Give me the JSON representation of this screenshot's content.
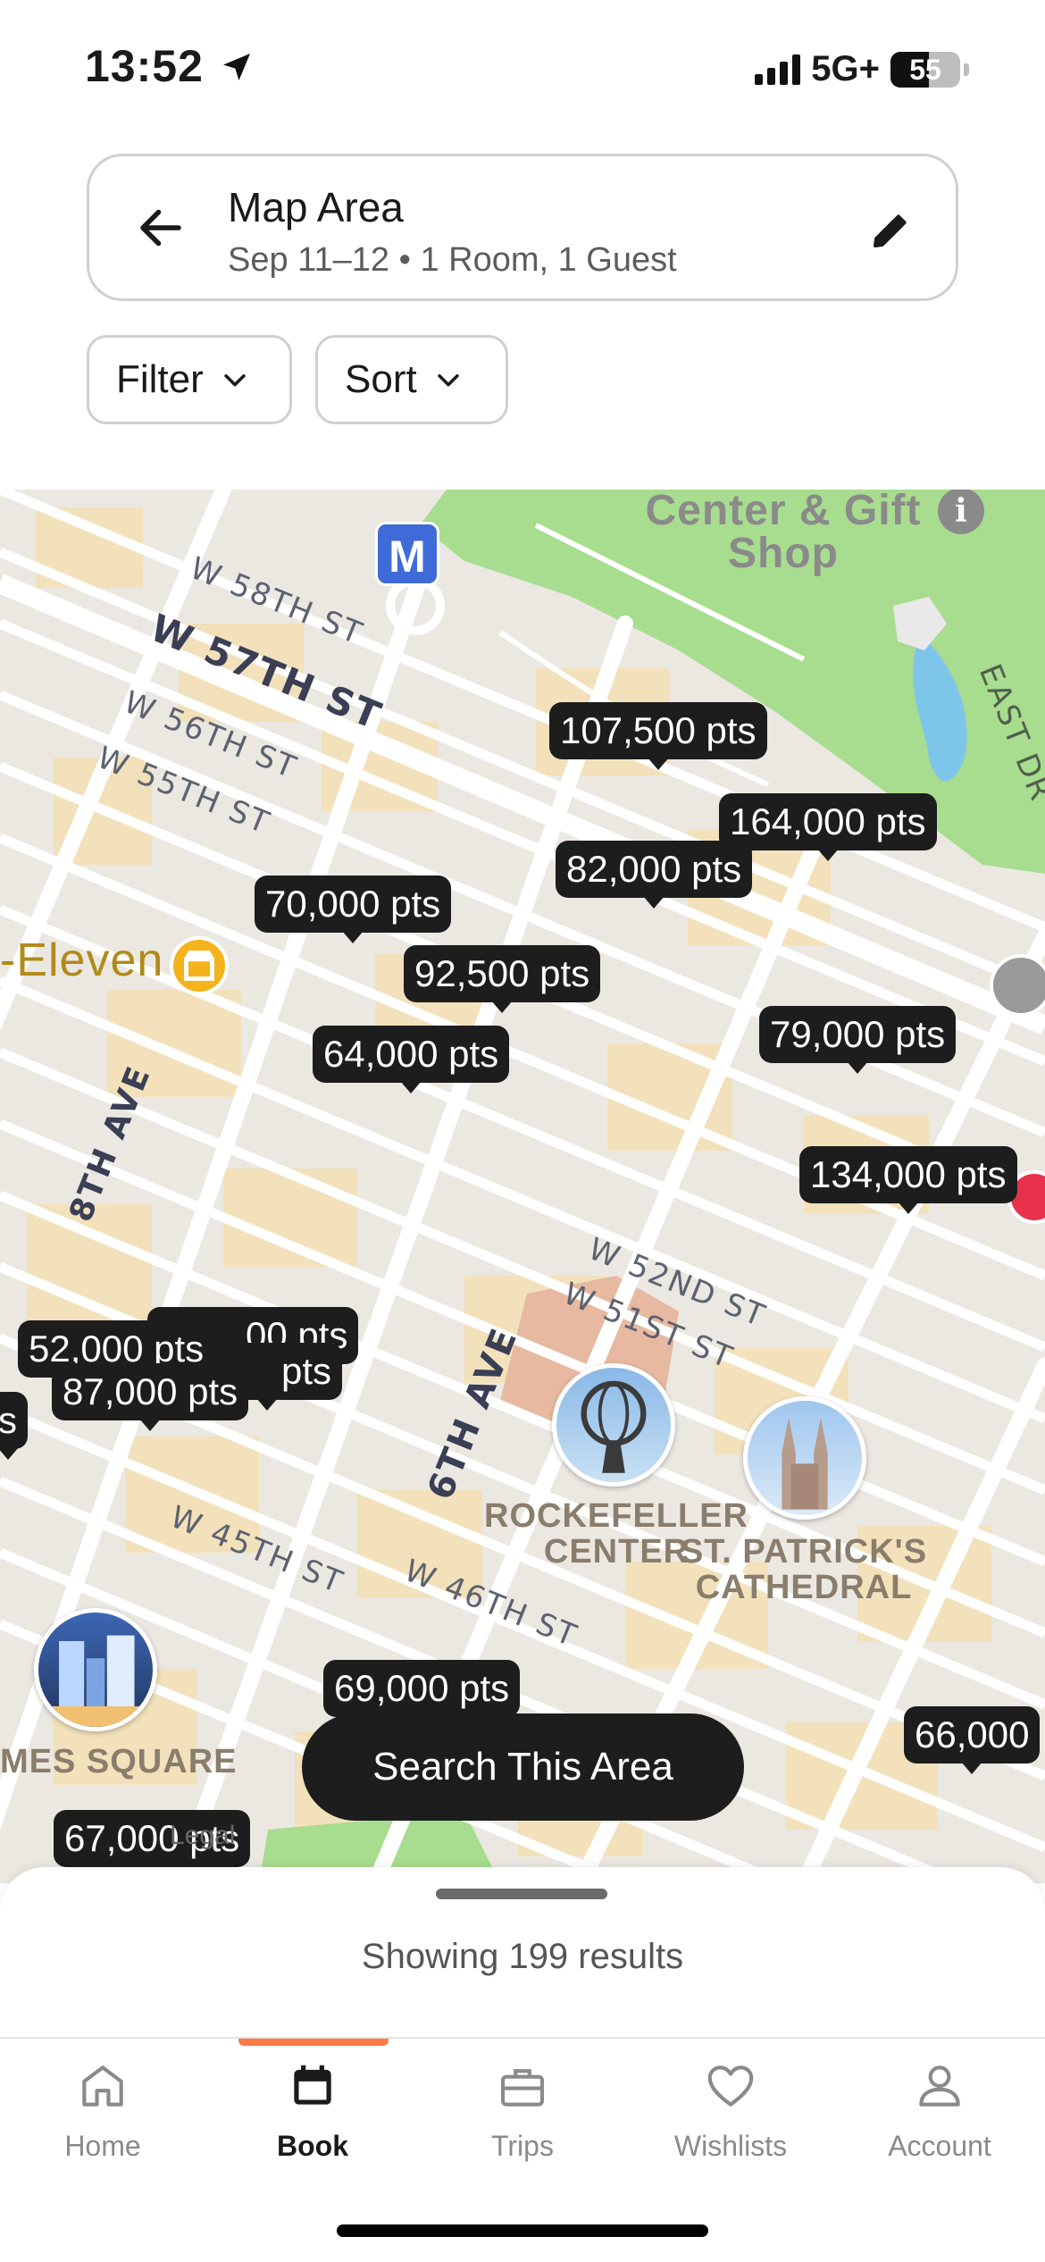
{
  "status_bar": {
    "time": "13:52",
    "network": "5G+",
    "battery": "55"
  },
  "search": {
    "title": "Map Area",
    "subtitle": "Sep 11–12 • 1 Room, 1 Guest"
  },
  "chips": {
    "filter": "Filter",
    "sort": "Sort"
  },
  "map": {
    "streets": {
      "s58": "W 58TH ST",
      "s57": "W 57TH ST",
      "s56": "W 56TH ST",
      "s55": "W 55TH ST",
      "s52": "W 52ND ST",
      "s51": "W 51ST ST",
      "s45": "W 45TH ST",
      "s46": "W 46TH ST",
      "ave8": "8TH AVE",
      "ave6": "6TH AVE",
      "east": "EAST DR"
    },
    "poi": {
      "gift_shop": "Center & Gift Shop",
      "seven_eleven": "-Eleven",
      "rockefeller": "ROCKEFELLER CENTER",
      "st_patricks": "ST. PATRICK'S CATHEDRAL",
      "times_square": "MES SQUARE",
      "metro": "M"
    },
    "pins": {
      "p107500": "107,500 pts",
      "p164000": "164,000 pts",
      "p82000": "82,000 pts",
      "p70000": "70,000 pts",
      "p92500": "92,500 pts",
      "p64000": "64,000 pts",
      "p79000": "79,000 pts",
      "p134000": "134,000 pts",
      "p52000": "52,000 pts",
      "p_hidden_a": "00 pts",
      "p_hidden_b": "pts",
      "p87000": "87,000 pts",
      "p_edge": "s",
      "p69000": "69,000 pts",
      "p66000": "66,000",
      "p67000": "67,000 pts"
    },
    "legal": "Legal"
  },
  "search_area_button": "Search This Area",
  "sheet": {
    "results": "Showing 199 results"
  },
  "tabs": [
    {
      "label": "Home",
      "icon": "home-icon"
    },
    {
      "label": "Book",
      "icon": "calendar-icon"
    },
    {
      "label": "Trips",
      "icon": "briefcase-icon"
    },
    {
      "label": "Wishlists",
      "icon": "heart-icon"
    },
    {
      "label": "Account",
      "icon": "person-icon"
    }
  ],
  "colors": {
    "accent": "#ff7a45",
    "pin": "#1d1d1d",
    "park": "#a8dc8f",
    "water": "#7ec6e9"
  }
}
